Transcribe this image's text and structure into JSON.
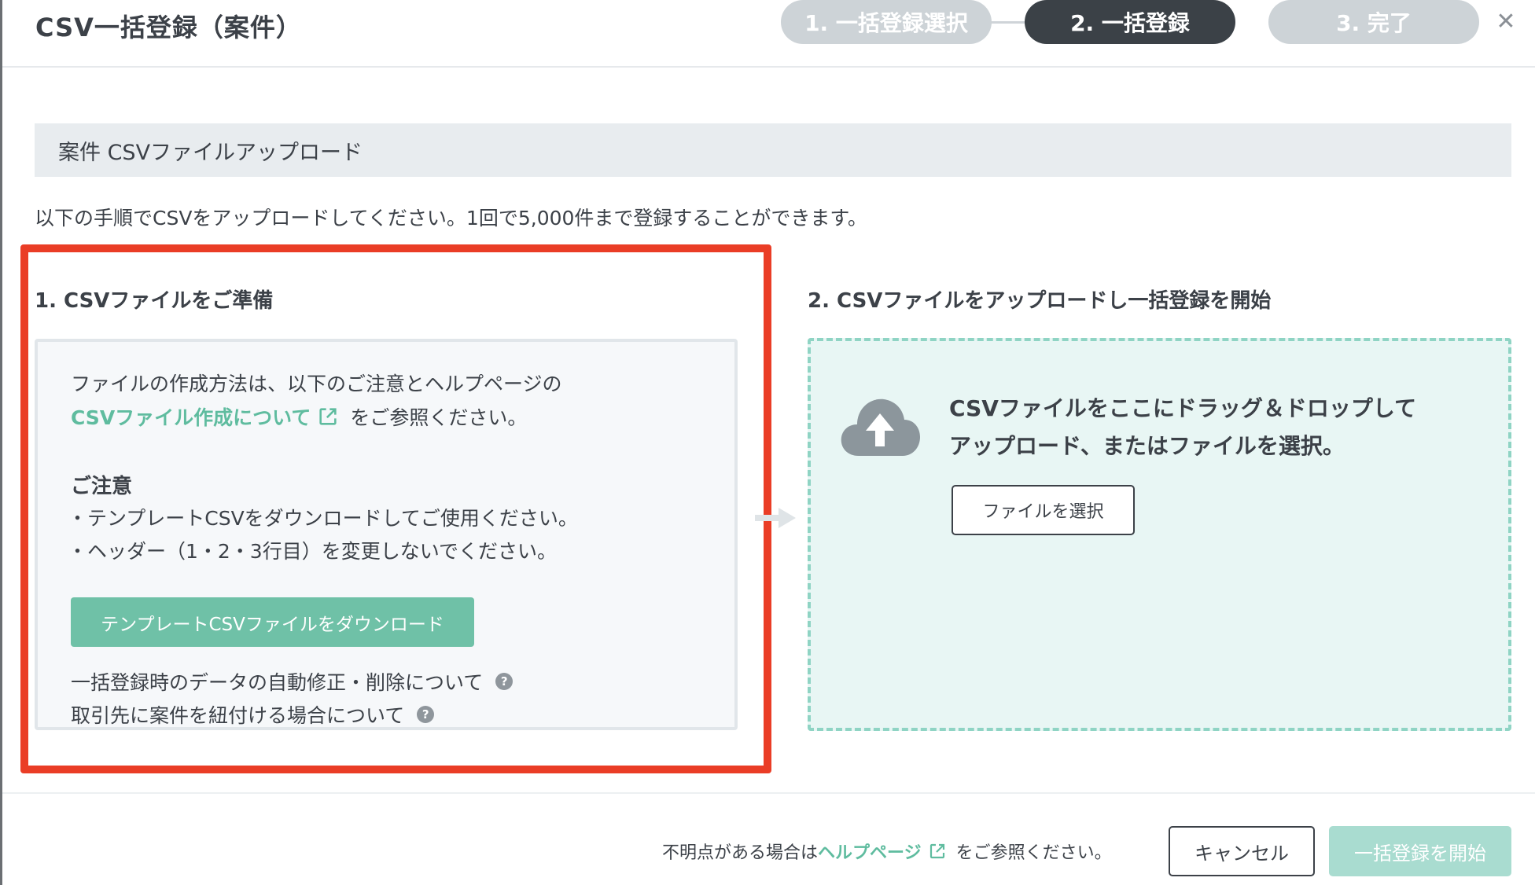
{
  "dialog": {
    "title": "CSV一括登録（案件）",
    "close_icon": "close-icon"
  },
  "stepper": {
    "steps": [
      {
        "label": "1. 一括登録選択",
        "state": "inactive"
      },
      {
        "label": "2. 一括登録",
        "state": "active"
      },
      {
        "label": "3. 完了",
        "state": "inactive"
      }
    ]
  },
  "section": {
    "title": "案件 CSVファイルアップロード",
    "intro": "以下の手順でCSVをアップロードしてください。1回で5,000件まで登録することができます。"
  },
  "prepare": {
    "title": "1. CSVファイルをご準備",
    "line1": "ファイルの作成方法は、以下のご注意とヘルプページの",
    "link_label": "CSVファイル作成について",
    "link_suffix": "をご参照ください。",
    "notes_title": "ご注意",
    "notes": [
      "・テンプレートCSVをダウンロードしてご使用ください。",
      "・ヘッダー（1・2・3行目）を変更しないでください。"
    ],
    "download_label": "テンプレートCSVファイルをダウンロード",
    "help_links": [
      "一括登録時のデータの自動修正・削除について",
      "取引先に案件を紐付ける場合について"
    ],
    "help_icon_glyph": "?"
  },
  "upload": {
    "title": "2. CSVファイルをアップロードし一括登録を開始",
    "drop_line1": "CSVファイルをここにドラッグ＆ドロップして",
    "drop_line2": "アップロード、またはファイルを選択。",
    "choose_label": "ファイルを選択"
  },
  "footer": {
    "note_prefix": "不明点がある場合は",
    "help_link": "ヘルプページ",
    "note_suffix": "をご参照ください。",
    "cancel_label": "キャンセル",
    "start_label": "一括登録を開始"
  },
  "colors": {
    "accent_green": "#6fc1a7",
    "link_green": "#5fbc9f",
    "active_step": "#3b4147",
    "inactive_step": "#cdd3d7",
    "highlight_red": "#ea3d26",
    "dropzone_bg": "#e8f6f4",
    "disabled_button": "#a9dcd0"
  }
}
